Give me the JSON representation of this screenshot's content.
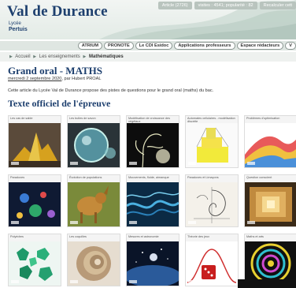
{
  "site": {
    "title": "Val de Durance",
    "sub1": "Lycée",
    "sub2": "Pertuis"
  },
  "topbar": {
    "articles": "Article (2726)",
    "visits": "visites : 4541; popularité : 82",
    "recalc": "Recalculer cett"
  },
  "nav": {
    "buttons": [
      "ATRIUM",
      "PRONOTE",
      "Le CDI Esidoc",
      "Applications professeurs",
      "Espace rédacteurs",
      "V"
    ]
  },
  "breadcrumb": {
    "home": "Accueil",
    "section": "Les enseignements",
    "current": "Mathématiques"
  },
  "article": {
    "title": "Grand oral - MATHS",
    "date": "mercredi 2 septembre 2020",
    "author_prefix": ", par ",
    "author": "Hubert PROAL",
    "intro": "Cette article du Lycée Val de Durance propose des pistes de questions pour le grand oral (maths) du bac.",
    "section_title": "Texte officiel de l'épreuve"
  },
  "gallery": [
    {
      "caption": "Les cas de sable"
    },
    {
      "caption": "Les bulles de savon"
    },
    {
      "caption": "Modélisation de croissance des végétaux"
    },
    {
      "caption": "Automates cellulaires - modélisation discrète"
    },
    {
      "caption": "Problèmes d'optimisation"
    },
    {
      "caption": "Paradoxes"
    },
    {
      "caption": "Évolution de populations"
    },
    {
      "caption": "Mouvements, fluide, aimanque"
    },
    {
      "caption": "Paradoxes et Limaçons"
    },
    {
      "caption": "Question conscient"
    },
    {
      "caption": "Polyèdres"
    },
    {
      "caption": "Les coquilles"
    },
    {
      "caption": "Mesures et astronomie"
    },
    {
      "caption": "Théorie des jeux"
    },
    {
      "caption": "Maths et arts"
    }
  ]
}
